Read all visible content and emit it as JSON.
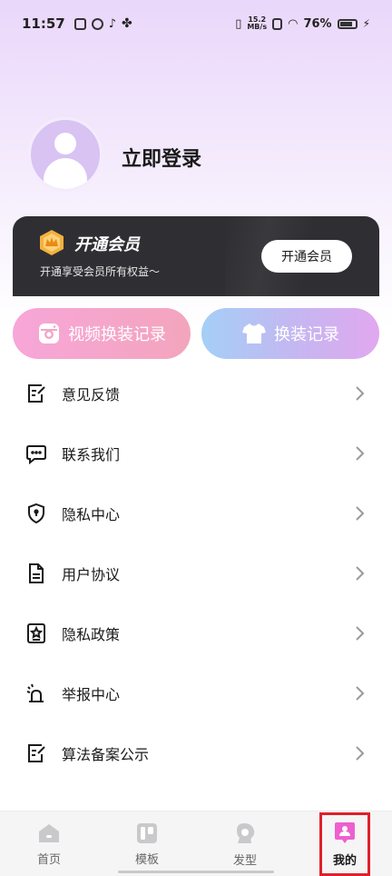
{
  "status_bar": {
    "time": "11:57",
    "net_speed_value": "15.2",
    "net_speed_unit": "MB/s",
    "battery": "76%"
  },
  "profile": {
    "login_label": "立即登录"
  },
  "vip": {
    "title": "开通会员",
    "subtitle": "开通享受会员所有权益～",
    "button_label": "开通会员"
  },
  "quick_actions": {
    "video_record_label": "视频换装记录",
    "change_record_label": "换装记录"
  },
  "menu": {
    "items": [
      {
        "label": "意见反馈",
        "icon": "feedback-icon"
      },
      {
        "label": "联系我们",
        "icon": "chat-icon"
      },
      {
        "label": "隐私中心",
        "icon": "shield-icon"
      },
      {
        "label": "用户协议",
        "icon": "document-icon"
      },
      {
        "label": "隐私政策",
        "icon": "badge-star-icon"
      },
      {
        "label": "举报中心",
        "icon": "alarm-icon"
      },
      {
        "label": "算法备案公示",
        "icon": "edit-icon"
      }
    ]
  },
  "tabbar": {
    "items": [
      {
        "label": "首页",
        "icon": "home-icon",
        "active": false
      },
      {
        "label": "模板",
        "icon": "template-icon",
        "active": false
      },
      {
        "label": "发型",
        "icon": "hairstyle-icon",
        "active": false
      },
      {
        "label": "我的",
        "icon": "profile-icon",
        "active": true
      }
    ]
  },
  "colors": {
    "accent": "#ee5fd0",
    "vip_card": "#2f2f33",
    "highlight_box": "#e0202a"
  }
}
